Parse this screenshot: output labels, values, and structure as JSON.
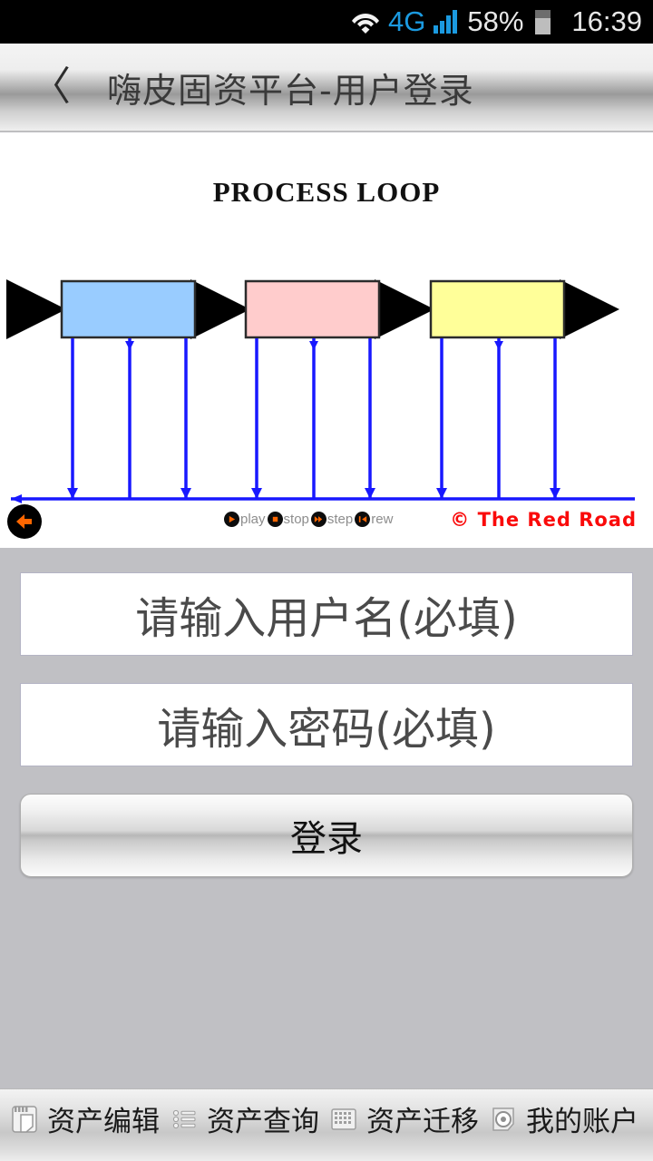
{
  "statusbar": {
    "wifi_icon": "wifi-icon",
    "network_label": "4G",
    "signal_icon": "signal-bars-icon",
    "battery_percent": "58%",
    "battery_icon": "battery-icon",
    "time": "16:39"
  },
  "titlebar": {
    "back_icon": "〈",
    "title": "嗨皮固资平台-用户登录"
  },
  "webview": {
    "diagram_title": "PROCESS LOOP",
    "credit": "© The Red Road",
    "rewind_button_icon": "circle-left-arrow-icon",
    "media_controls": [
      {
        "icon": "play-icon",
        "label": "play"
      },
      {
        "icon": "stop-icon",
        "label": "stop"
      },
      {
        "icon": "step-icon",
        "label": "step"
      },
      {
        "icon": "rewind-icon",
        "label": "rew"
      }
    ],
    "boxes": [
      {
        "name": "process-box-1",
        "color": "#99ccff"
      },
      {
        "name": "process-box-2",
        "color": "#ffcccc"
      },
      {
        "name": "process-box-3",
        "color": "#ffff99"
      }
    ],
    "arrow_color": "#000000",
    "feedback_line_color": "#0000ff"
  },
  "form": {
    "username_placeholder": "请输入用户名(必填)",
    "username_value": "",
    "password_placeholder": "请输入密码(必填)",
    "password_value": "",
    "login_label": "登录"
  },
  "bottomnav": {
    "items": [
      {
        "icon": "notepad-edit-icon",
        "label": "资产编辑"
      },
      {
        "icon": "list-icon",
        "label": "资产查询"
      },
      {
        "icon": "grid-icon",
        "label": "资产迁移"
      },
      {
        "icon": "disc-icon",
        "label": "我的账户"
      }
    ]
  },
  "colors": {
    "status_bar_bg": "#000000",
    "accent_blue": "#1b9ae0",
    "page_bg": "#c0c0c4",
    "credit_red": "#fa0a0a",
    "media_orange": "#ff6600"
  }
}
